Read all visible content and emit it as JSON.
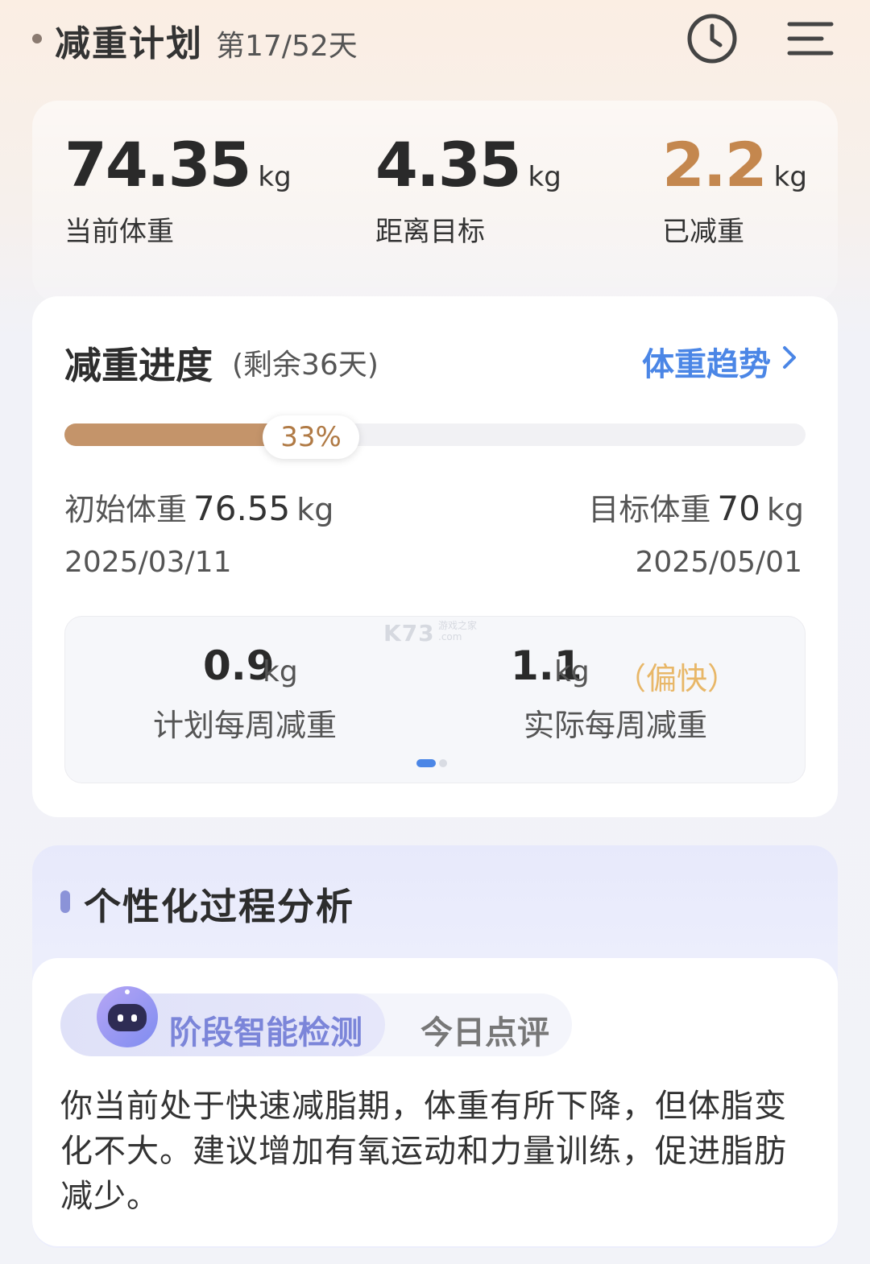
{
  "header": {
    "title": "减重计划",
    "day": "第17/52天"
  },
  "stats": [
    {
      "value": "74.35",
      "unit": "kg",
      "label": "当前体重"
    },
    {
      "value": "4.35",
      "unit": "kg",
      "label": "距离目标"
    },
    {
      "value": "2.2",
      "unit": "kg",
      "label": "已减重",
      "color": "#c4874e"
    }
  ],
  "progress": {
    "title": "减重进度",
    "remaining": "(剩余36天)",
    "trend_link": "体重趋势",
    "percent_label": "33%",
    "fraction": 0.33,
    "start_label": "初始体重",
    "start_value": "76.55",
    "start_unit": "kg",
    "target_label": "目标体重",
    "target_value": "70",
    "target_unit": "kg",
    "start_date": "2025/03/11",
    "target_date": "2025/05/01"
  },
  "weekly": {
    "plan_value": "0.9",
    "plan_unit": "kg",
    "plan_label": "计划每周减重",
    "actual_value": "1.1",
    "actual_unit": "kg",
    "actual_note": "（偏快）",
    "actual_label": "实际每周减重",
    "watermark": "K73",
    "watermark_sub1": "游戏之家",
    "watermark_sub2": ".com"
  },
  "analysis": {
    "title": "个性化过程分析",
    "tab_active": "阶段智能检测",
    "tab_other": "今日点评",
    "text": "你当前处于快速减脂期，体重有所下降，但体脂变化不大。建议增加有氧运动和力量训练，促进脂肪减少。"
  },
  "colors": {
    "accent_blue": "#4b86e6",
    "progress_brown": "#c4946a",
    "orange": "#c4874e"
  }
}
